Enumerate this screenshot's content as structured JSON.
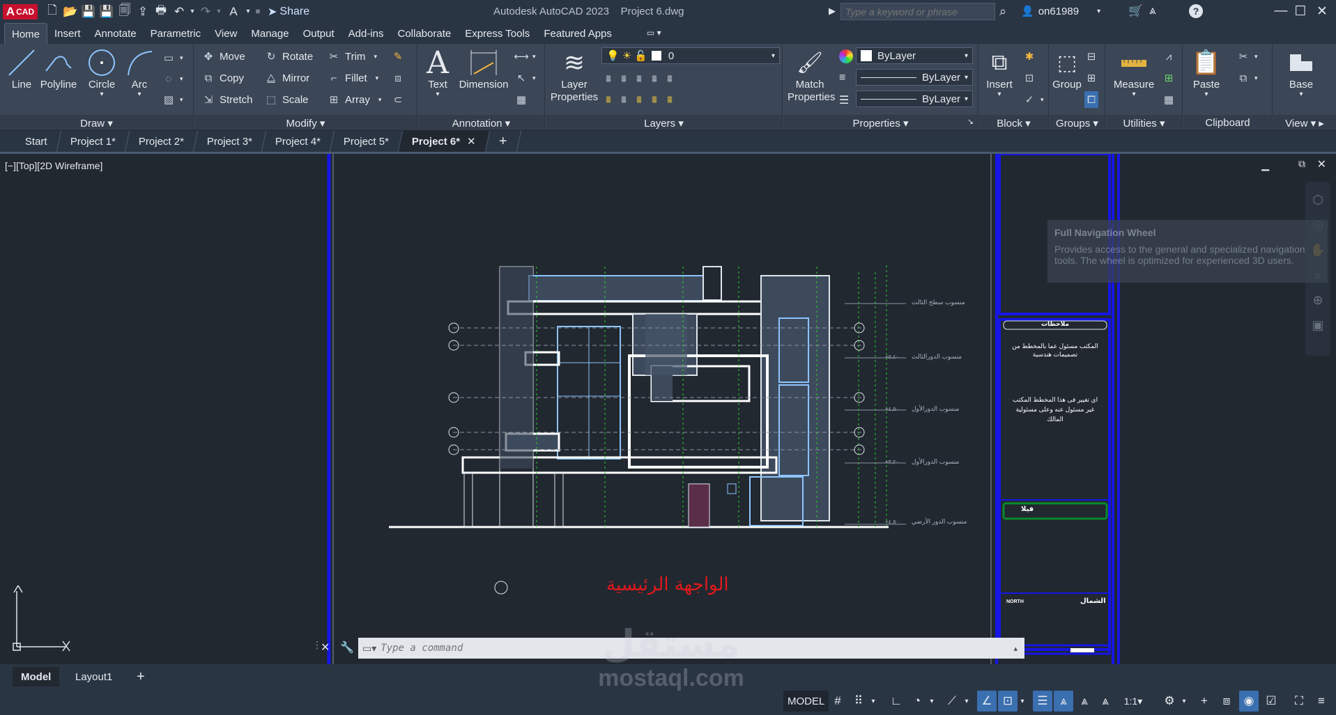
{
  "app": {
    "badge": "CAD",
    "title": "Autodesk AutoCAD 2023    Project 6.dwg",
    "share_label": "Share",
    "search_placeholder": "Type a keyword or phrase",
    "username": "on61989"
  },
  "ribbon_tabs": [
    "Home",
    "Insert",
    "Annotate",
    "Parametric",
    "View",
    "Manage",
    "Output",
    "Add-ins",
    "Collaborate",
    "Express Tools",
    "Featured Apps"
  ],
  "draw": {
    "label": "Draw",
    "line": "Line",
    "polyline": "Polyline",
    "circle": "Circle",
    "arc": "Arc"
  },
  "modify": {
    "label": "Modify",
    "move": "Move",
    "rotate": "Rotate",
    "trim": "Trim",
    "copy": "Copy",
    "mirror": "Mirror",
    "fillet": "Fillet",
    "stretch": "Stretch",
    "scale": "Scale",
    "array": "Array"
  },
  "annotation": {
    "label": "Annotation",
    "text": "Text",
    "dimension": "Dimension"
  },
  "layers": {
    "label": "Layers",
    "layer_properties": "Layer Properties",
    "current_layer": "0"
  },
  "properties": {
    "label": "Properties",
    "match": "Match Properties",
    "color": "ByLayer",
    "linetype": "ByLayer",
    "lineweight": "ByLayer"
  },
  "block": {
    "label": "Block",
    "insert": "Insert"
  },
  "groups": {
    "label": "Groups",
    "group": "Group"
  },
  "utilities": {
    "label": "Utilities",
    "measure": "Measure"
  },
  "clipboard": {
    "label": "Clipboard",
    "paste": "Paste"
  },
  "view": {
    "label": "View",
    "base": "Base"
  },
  "doc_tabs": [
    "Start",
    "Project 1*",
    "Project 2*",
    "Project 3*",
    "Project 4*",
    "Project 5*",
    "Project 6*"
  ],
  "viewport": {
    "label": "[−][Top][2D Wireframe]"
  },
  "tooltip": {
    "title": "Full Navigation Wheel",
    "body": "Provides access to the general and specialized navigation tools. The wheel is optimized for experienced 3D users."
  },
  "drawing": {
    "title": "الواجهة الرئيسية",
    "levels": [
      "منسوب سطح الثالث",
      "منسوب الدورالثالث",
      "منسوب الدورالأول",
      "منسوب الدورالأول",
      "منسوب الدور الأرضي"
    ],
    "level_values": [
      "+٥,٤٠",
      "+٤,٥٠",
      "+٣,٢٠",
      "+٤,٥٠",
      "+٠,٠٠"
    ],
    "sheet_notes_title": "ملاحظات",
    "sheet_note_1": "المكتب مسئول عما بالمخطط من تصميمات هندسية",
    "sheet_note_2": "اى تغيير فى هذا المخطط المكتب غير مسئول عنه وعلى مسئولية المالك",
    "sheet_project": "فيلا",
    "north_label": "الشمال",
    "north_en": "NORTH"
  },
  "command": {
    "placeholder": "Type a command"
  },
  "layout_tabs": [
    "Model",
    "Layout1"
  ],
  "status": {
    "model": "MODEL",
    "scale": "1:1"
  },
  "watermark": {
    "arabic": "مستقل",
    "latin": "mostaql.com"
  },
  "colors": {
    "accent": "#3a6fb0",
    "frame_blue": "#1616e6",
    "title_red": "#e0191c",
    "bg": "#212830"
  }
}
